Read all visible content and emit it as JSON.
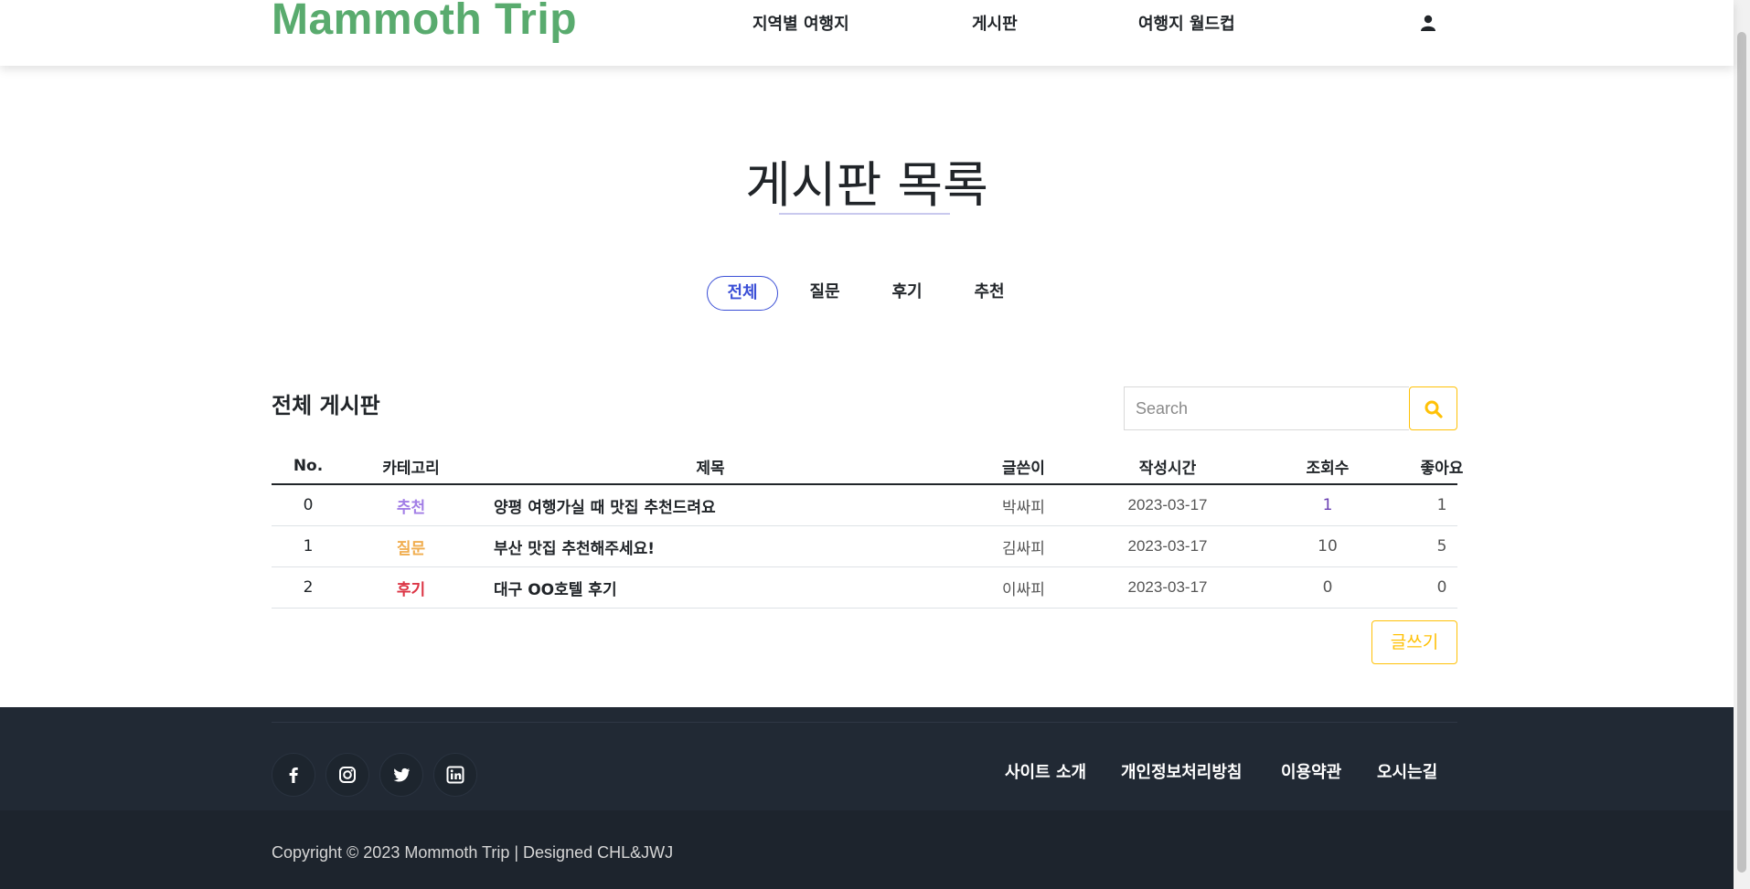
{
  "header": {
    "logo": "Mammoth Trip",
    "nav": [
      "지역별 여행지",
      "게시판",
      "여행지 월드컵"
    ],
    "user_icon": "user-icon"
  },
  "page": {
    "title": "게시판 목록"
  },
  "tabs": [
    {
      "label": "전체",
      "active": true
    },
    {
      "label": "질문",
      "active": false
    },
    {
      "label": "후기",
      "active": false
    },
    {
      "label": "추천",
      "active": false
    }
  ],
  "board": {
    "heading": "전체 게시판",
    "search_placeholder": "Search",
    "search_icon": "search-icon",
    "columns": [
      "No.",
      "카테고리",
      "제목",
      "글쓴이",
      "작성시간",
      "조회수",
      "좋아요"
    ],
    "rows": [
      {
        "no": "0",
        "category": "추천",
        "category_color": "#a27ee6",
        "title": "양평 여행가실 때 맛집 추천드려요",
        "author": "박싸피",
        "date": "2023-03-17",
        "views": "1",
        "likes": "1"
      },
      {
        "no": "1",
        "category": "질문",
        "category_color": "#f0ad4e",
        "title": "부산 맛집 추천해주세요!",
        "author": "김싸피",
        "date": "2023-03-17",
        "views": "10",
        "likes": "5"
      },
      {
        "no": "2",
        "category": "후기",
        "category_color": "#dc3545",
        "title": "대구 OO호텔 후기",
        "author": "이싸피",
        "date": "2023-03-17",
        "views": "0",
        "likes": "0"
      }
    ],
    "write_button": "글쓰기"
  },
  "footer": {
    "social_icons": [
      "facebook-icon",
      "instagram-icon",
      "twitter-icon",
      "linkedin-icon"
    ],
    "links": [
      "사이트 소개",
      "개인정보처리방침",
      "이용약관",
      "오시는길"
    ],
    "copyright": "Copyright © 2023 Mommoth Trip | Designed CHL&JWJ"
  },
  "colors": {
    "brand": "#59ab6e",
    "accent": "#ffc107",
    "tab_active": "#3b4fd6",
    "footer_bg": "#212934"
  }
}
